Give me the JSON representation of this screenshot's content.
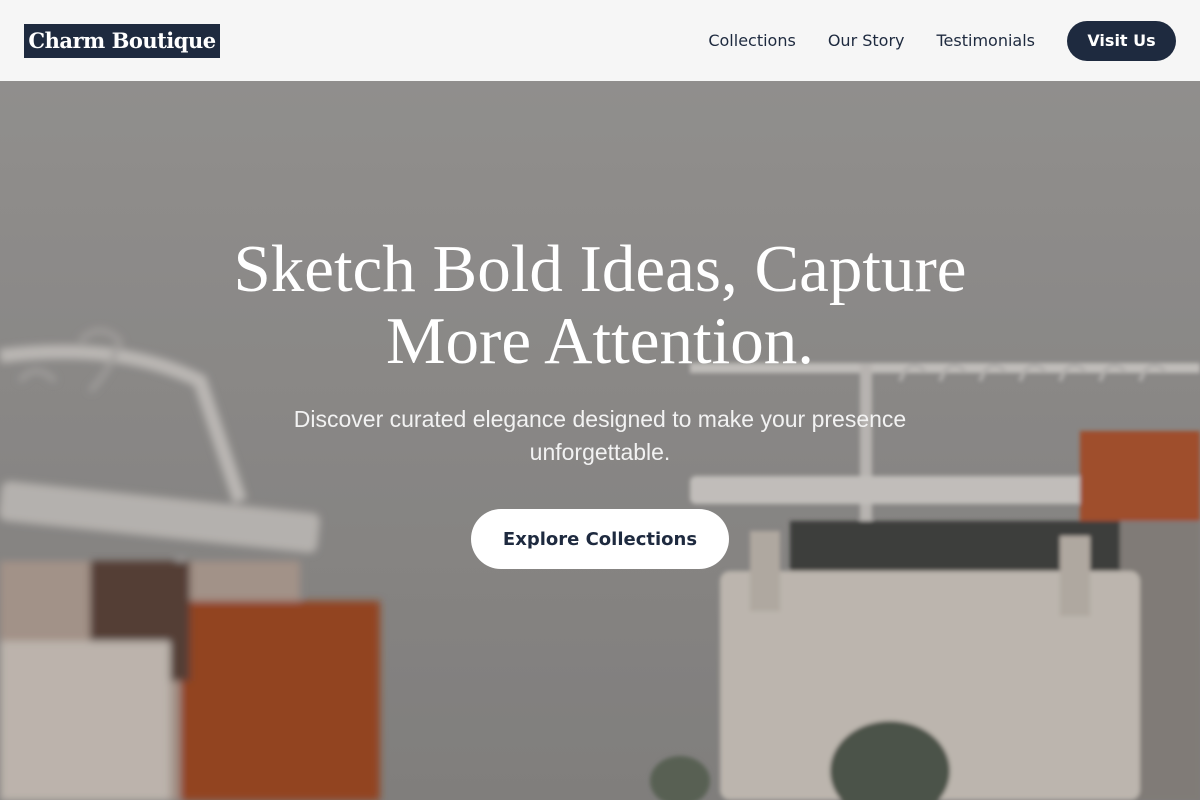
{
  "header": {
    "logo": "Charm Boutique",
    "nav": [
      {
        "label": "Collections"
      },
      {
        "label": "Our Story"
      },
      {
        "label": "Testimonials"
      }
    ],
    "cta_label": "Visit Us"
  },
  "hero": {
    "title": "Sketch Bold Ideas, Capture More Attention.",
    "subtitle": "Discover curated elegance designed to make your presence unforgettable.",
    "cta_label": "Explore Collections",
    "background_image": "clothing-racks-photo"
  },
  "colors": {
    "brand_navy": "#1e2a3f",
    "header_bg": "#f6f6f6",
    "white": "#ffffff"
  }
}
